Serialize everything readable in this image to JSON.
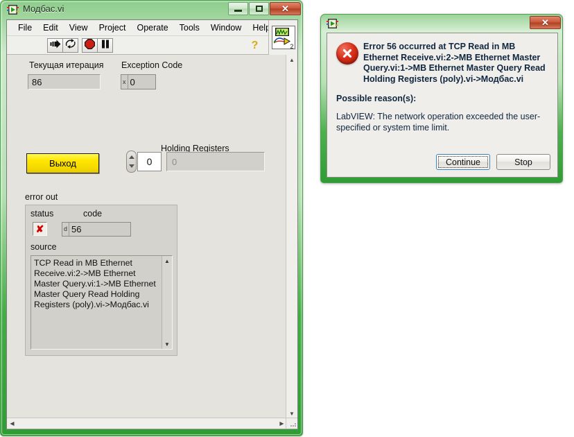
{
  "vi_window": {
    "title": "Модбас.vi",
    "title_icon": "labview-vi-icon",
    "window_buttons": {
      "minimize": "minimize-button",
      "maximize": "maximize-button",
      "close": "✕"
    },
    "menu": [
      "File",
      "Edit",
      "View",
      "Project",
      "Operate",
      "Tools",
      "Window",
      "Help"
    ],
    "toolbar": {
      "run": "run-arrow-icon",
      "run_continuously": "run-continuously-icon",
      "abort": "abort-execution-icon",
      "pause": "pause-icon",
      "help": "?",
      "vi_icon_number": "2"
    },
    "panel": {
      "iteration": {
        "label": "Текущая итерация",
        "value": "86"
      },
      "exception_code": {
        "label": "Exception Code",
        "radix": "x",
        "value": "0"
      },
      "exit_button": {
        "label": "Выход"
      },
      "holding_registers": {
        "label": "Holding Registers",
        "index": "0",
        "element": "0"
      },
      "error_out": {
        "label": "error out",
        "status_label": "status",
        "status_value": "✘",
        "code_label": "code",
        "code_radix": "d",
        "code_value": "56",
        "source_label": "source",
        "source_value": "TCP Read in MB Ethernet Receive.vi:2->MB Ethernet Master Query.vi:1->MB Ethernet Master Query Read Holding Registers (poly).vi->Модбас.vi"
      }
    }
  },
  "dialog": {
    "title_icon": "labview-vi-icon",
    "close_label": "✕",
    "error_icon": "error-circle-icon",
    "message": "Error 56 occurred at TCP Read in MB Ethernet Receive.vi:2->MB Ethernet Master Query.vi:1->MB Ethernet Master Query Read Holding Registers (poly).vi->Модбас.vi",
    "reason_header": "Possible reason(s):",
    "reason_body": "LabVIEW:  The network operation exceeded the user-specified or system time limit.",
    "continue_label": "Continue",
    "stop_label": "Stop"
  },
  "colors": {
    "frame_green": "#43ad45",
    "panel_gray": "#e5e3dd",
    "button_yellow": "#ffe600",
    "error_red": "#d9301a",
    "close_red": "#c9573a"
  }
}
